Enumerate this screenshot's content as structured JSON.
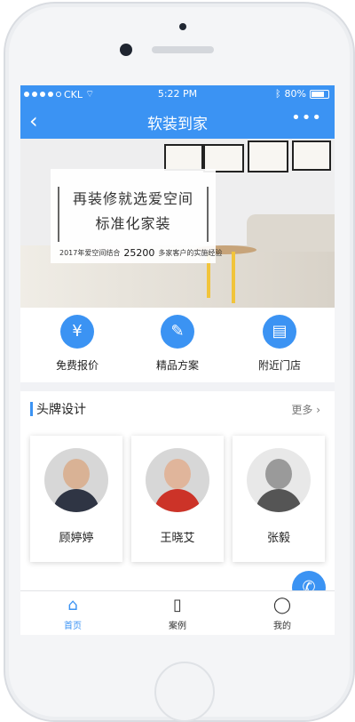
{
  "status_bar": {
    "carrier": "CKL",
    "time": "5:22 PM",
    "battery": "80%"
  },
  "nav": {
    "title": "软装到家",
    "back_icon": "‹",
    "more_icon": "•••"
  },
  "banner": {
    "line1": "再装修就选爱空间",
    "line2": "标准化家装",
    "note_prefix": "2017年爱空间结合",
    "note_number": "25200",
    "note_suffix": "多家客户的实施经验"
  },
  "features": [
    {
      "label": "免费报价",
      "icon": "price-tag-icon"
    },
    {
      "label": "精品方案",
      "icon": "pencil-ruler-icon"
    },
    {
      "label": "附近门店",
      "icon": "store-icon"
    }
  ],
  "section": {
    "title": "头牌设计",
    "more": "更多 ›"
  },
  "designers": [
    {
      "name": "顾婷婷"
    },
    {
      "name": "王晓艾"
    },
    {
      "name": "张毅"
    }
  ],
  "tabs": [
    {
      "label": "首页",
      "icon": "home-icon"
    },
    {
      "label": "案例",
      "icon": "document-icon"
    },
    {
      "label": "我的",
      "icon": "user-icon"
    }
  ],
  "colors": {
    "accent": "#3b93f3",
    "text": "#222222"
  }
}
